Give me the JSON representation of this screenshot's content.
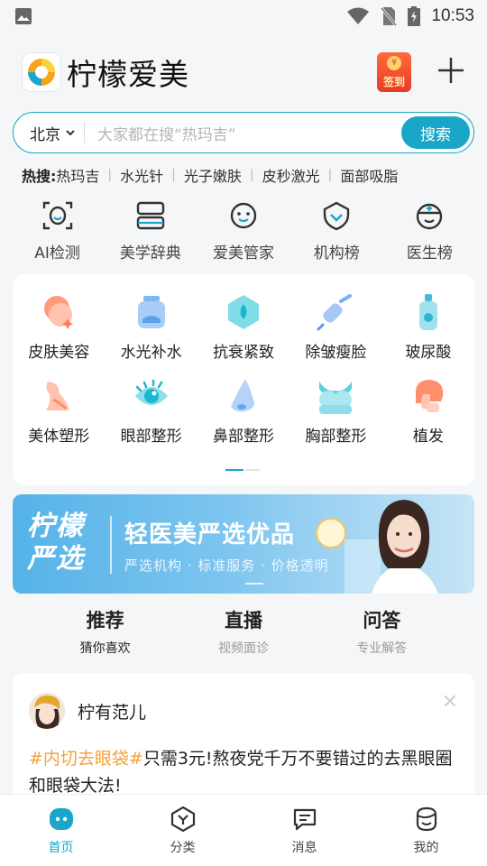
{
  "status_bar": {
    "time": "10:53"
  },
  "header": {
    "app_title": "柠檬爱美",
    "signin_label": "签到",
    "signin_coin": "¥"
  },
  "search": {
    "city": "北京",
    "placeholder": "大家都在搜“热玛吉”",
    "button": "搜索"
  },
  "hot_search": {
    "label": "热搜:",
    "items": [
      "热玛吉",
      "水光针",
      "光子嫩肤",
      "皮秒激光",
      "面部吸脂"
    ]
  },
  "quick_entries": [
    {
      "label": "AI检测",
      "icon": "ai-face-scan-icon"
    },
    {
      "label": "美学辞典",
      "icon": "dictionary-icon"
    },
    {
      "label": "爱美管家",
      "icon": "butler-face-icon"
    },
    {
      "label": "机构榜",
      "icon": "institution-rank-icon"
    },
    {
      "label": "医生榜",
      "icon": "doctor-rank-icon"
    }
  ],
  "categories": [
    {
      "label": "皮肤美容",
      "icon": "skin-care-icon"
    },
    {
      "label": "水光补水",
      "icon": "hydration-icon"
    },
    {
      "label": "抗衰紧致",
      "icon": "anti-aging-icon"
    },
    {
      "label": "除皱瘦脸",
      "icon": "wrinkle-removal-icon"
    },
    {
      "label": "玻尿酸",
      "icon": "hyaluronic-acid-icon"
    },
    {
      "label": "美体塑形",
      "icon": "body-shaping-icon"
    },
    {
      "label": "眼部整形",
      "icon": "eye-surgery-icon"
    },
    {
      "label": "鼻部整形",
      "icon": "nose-surgery-icon"
    },
    {
      "label": "胸部整形",
      "icon": "breast-surgery-icon"
    },
    {
      "label": "植发",
      "icon": "hair-transplant-icon"
    }
  ],
  "banner": {
    "brand_line1": "柠檬",
    "brand_line2": "严选",
    "headline": "轻医美严选优品",
    "subtitle": "严选机构 · 标准服务 · 价格透明"
  },
  "content_tabs": [
    {
      "title": "推荐",
      "subtitle": "猜你喜欢",
      "active": true
    },
    {
      "title": "直播",
      "subtitle": "视频面诊",
      "active": false
    },
    {
      "title": "问答",
      "subtitle": "专业解答",
      "active": false
    }
  ],
  "feed_post": {
    "username": "柠有范儿",
    "tag": "#内切去眼袋#",
    "text": "只需3元!熬夜党千万不要错过的去黑眼圈和眼袋大法!"
  },
  "bottom_nav": [
    {
      "label": "首页",
      "icon": "home-icon",
      "active": true
    },
    {
      "label": "分类",
      "icon": "category-icon",
      "active": false
    },
    {
      "label": "消息",
      "icon": "message-icon",
      "active": false
    },
    {
      "label": "我的",
      "icon": "profile-icon",
      "active": false
    }
  ],
  "colors": {
    "accent": "#1aa6c9",
    "tag": "#f2a23c",
    "signin": "#e83a25"
  }
}
